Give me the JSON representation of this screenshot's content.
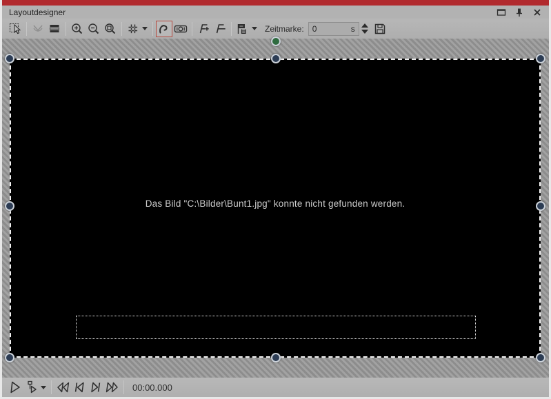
{
  "window": {
    "title": "Layoutdesigner",
    "accent_color": "#b12a2e",
    "controls": {
      "maximize": "maximize-window",
      "pin": "pin-panel",
      "close": "close-panel"
    }
  },
  "toolbar": {
    "tools": [
      "select",
      "smooth-selection",
      "layers",
      "zoom-in",
      "zoom-out",
      "zoom-fit",
      "grid",
      "motion-path",
      "camera-pan",
      "fade-in",
      "fade-out",
      "timemark"
    ],
    "active_tool": "motion-path",
    "active_tool_border_color": "#b5493e",
    "zeitmarke": {
      "label": "Zeitmarke:",
      "value": "0",
      "unit": "s"
    },
    "save_icon": "save"
  },
  "canvas": {
    "error_text": "Das Bild \"C:\\Bilder\\Bunt1.jpg\" konnte nicht gefunden werden.",
    "selection_handle_color": "#2c3c54",
    "rotation_handle_color": "#2f6b3f"
  },
  "transport": {
    "buttons": [
      "play",
      "play-from-timemark",
      "skip-to-start",
      "step-back",
      "step-forward",
      "skip-to-end"
    ],
    "time": "00:00.000"
  }
}
